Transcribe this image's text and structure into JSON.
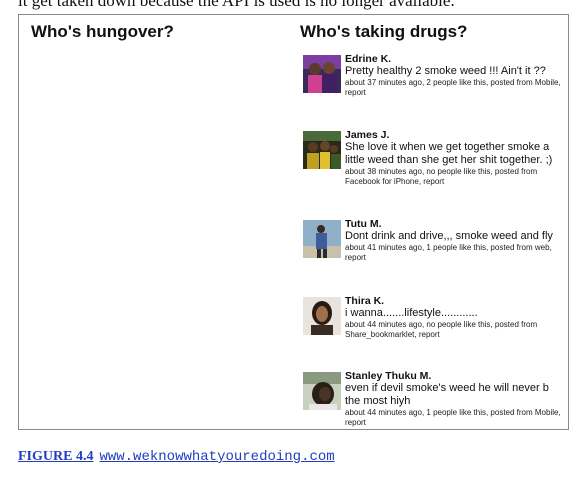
{
  "top_text": "it get taken down because the API is used is no longer available.",
  "left_column": {
    "title": "Who's hungover?"
  },
  "right_column": {
    "title": "Who's taking drugs?"
  },
  "posts": [
    {
      "author": "Edrine K.",
      "text": "Pretty healthy 2 smoke weed !!! Ain't it ??",
      "meta": "about 37 minutes ago, 2 people like this, posted from Mobile,",
      "report": "report"
    },
    {
      "author": "James J.",
      "text": "She love it when we get together smoke a little weed than she get her shit together. ;)",
      "meta": "about 38 minutes ago, no people like this, posted from Facebook for iPhone,",
      "report": "report"
    },
    {
      "author": "Tutu M.",
      "text": "Dont drink and drive,,, smoke weed and fly",
      "meta": "about 41 minutes ago, 1 people like this, posted from web,",
      "report": "report"
    },
    {
      "author": "Thira K.",
      "text": "i wanna.......lifestyle............",
      "meta": "about 44 minutes ago, no people like this, posted from Share_bookmarklet,",
      "report": "report"
    },
    {
      "author": "Stanley Thuku M.",
      "text": "even if devil smoke's weed he will never b the most hiyh",
      "meta": "about 44 minutes ago, 1 people like this, posted from Mobile,",
      "report": "report"
    }
  ],
  "caption": {
    "label": "FIGURE 4.4",
    "url": "www.weknowwhatyouredoing.com"
  }
}
